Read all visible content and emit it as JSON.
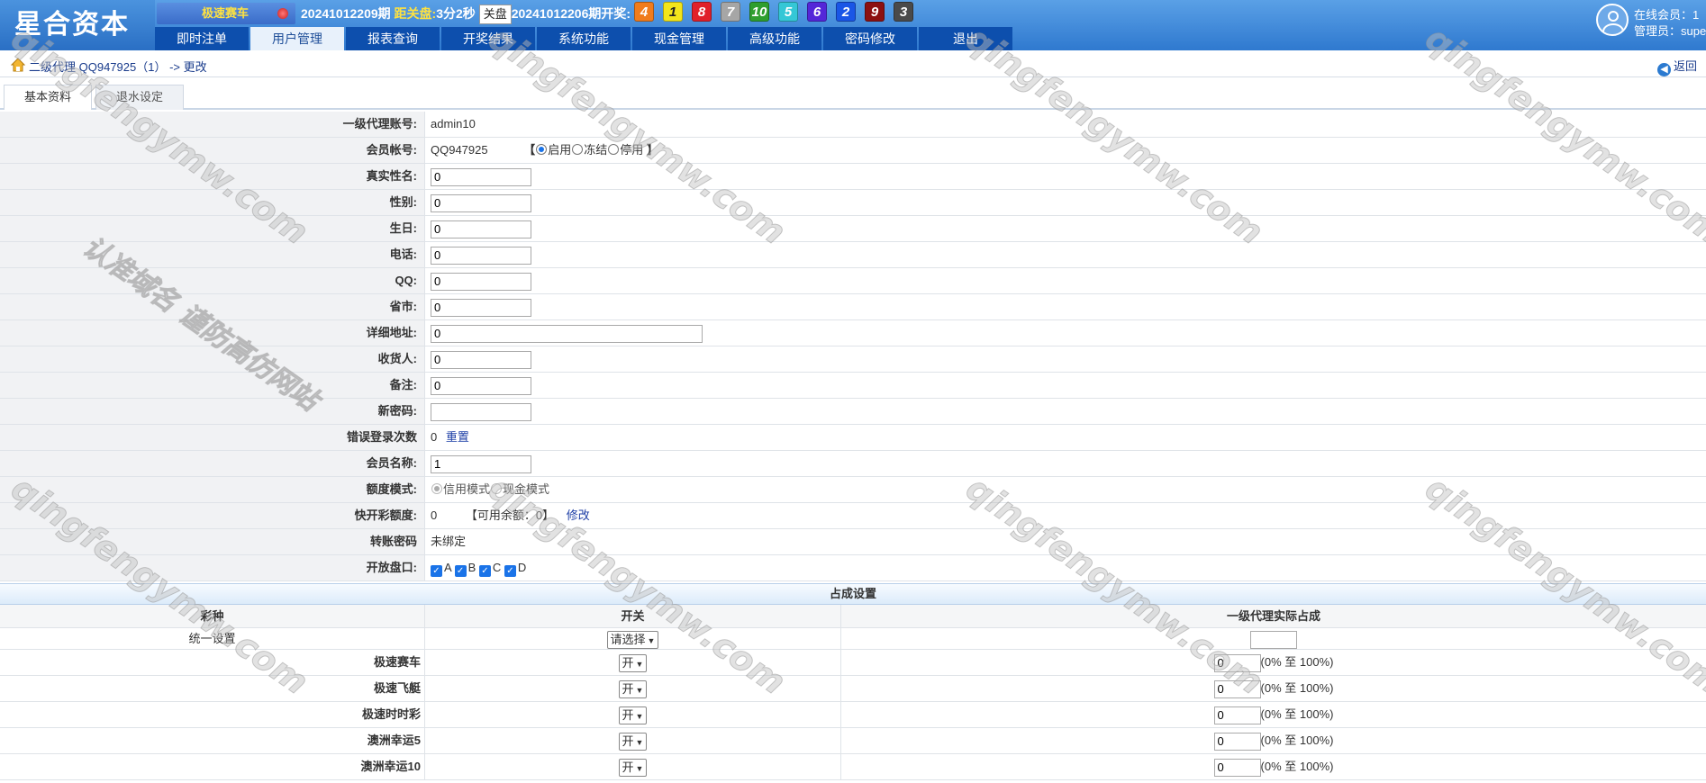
{
  "header": {
    "logo": "星合资本",
    "lottery_name": "极速赛车",
    "current_issue": "20241012209期",
    "close_label": "距关盘:",
    "countdown": "3分2秒",
    "close_button": "关盘",
    "last_issue": "20241012206期开奖:",
    "balls": [
      {
        "n": "4",
        "color": "#f07c1c"
      },
      {
        "n": "1",
        "color": "#f2e51b"
      },
      {
        "n": "8",
        "color": "#e0202a"
      },
      {
        "n": "7",
        "color": "#a6a6a6"
      },
      {
        "n": "10",
        "color": "#2f9e2f"
      },
      {
        "n": "5",
        "color": "#35c7d6"
      },
      {
        "n": "6",
        "color": "#5426d8"
      },
      {
        "n": "2",
        "color": "#1a56e6"
      },
      {
        "n": "9",
        "color": "#8c1010"
      },
      {
        "n": "3",
        "color": "#4a4a4a"
      }
    ],
    "online_label": "在线会员：1",
    "admin_label": "管理员：super"
  },
  "nav": [
    "即时注单",
    "用户管理",
    "报表查询",
    "开奖结果",
    "系统功能",
    "现金管理",
    "高级功能",
    "密码修改",
    "退出"
  ],
  "breadcrumb": {
    "path": "二级代理 QQ947925（1）",
    "action": "-> 更改",
    "back": "返回"
  },
  "tabs": [
    "基本资料",
    "退水设定"
  ],
  "form": {
    "agent_label": "一级代理账号:",
    "agent_value": "admin10",
    "member_label": "会员帐号:",
    "member_value": "QQ947925",
    "status_open": "启用",
    "status_freeze": "冻结",
    "status_disable": "停用",
    "realname_label": "真实性名:",
    "realname_value": "0",
    "gender_label": "性别:",
    "gender_value": "0",
    "birthday_label": "生日:",
    "birthday_value": "0",
    "phone_label": "电话:",
    "phone_value": "0",
    "qq_label": "QQ:",
    "qq_value": "0",
    "city_label": "省市:",
    "city_value": "0",
    "address_label": "详细地址:",
    "address_value": "0",
    "receiver_label": "收货人:",
    "receiver_value": "0",
    "note_label": "备注:",
    "note_value": "0",
    "newpwd_label": "新密码:",
    "newpwd_value": "",
    "errcount_label": "错误登录次数",
    "errcount_value": "0",
    "reset_label": "重置",
    "nickname_label": "会员名称:",
    "nickname_value": "1",
    "quota_mode_label": "额度模式:",
    "quota_credit": "信用模式",
    "quota_cash": "现金模式",
    "fast_quota_label": "快开彩额度:",
    "fast_quota_value": "0",
    "available_label": "【可用余额：",
    "available_value": "0】",
    "modify_label": "修改",
    "transfer_pwd_label": "转账密码",
    "transfer_pwd_value": "未绑定",
    "plates_label": "开放盘口:",
    "plates": [
      "A",
      "B",
      "C",
      "D"
    ]
  },
  "share": {
    "title": "占成设置",
    "col_game": "彩种",
    "col_switch": "开关",
    "col_share": "一级代理实际占成",
    "unify_label": "统一设置",
    "unify_select": "请选择",
    "switch_open": "开",
    "range_text": "(0% 至 100%)",
    "rows": [
      {
        "name": "极速赛车",
        "value": "0"
      },
      {
        "name": "极速飞艇",
        "value": "0"
      },
      {
        "name": "极速时时彩",
        "value": "0"
      },
      {
        "name": "澳洲幸运5",
        "value": "0"
      },
      {
        "name": "澳洲幸运10",
        "value": "0"
      }
    ]
  },
  "watermark": "qingfengymw.com",
  "watermark2": "认准域名 谨防高仿网站"
}
